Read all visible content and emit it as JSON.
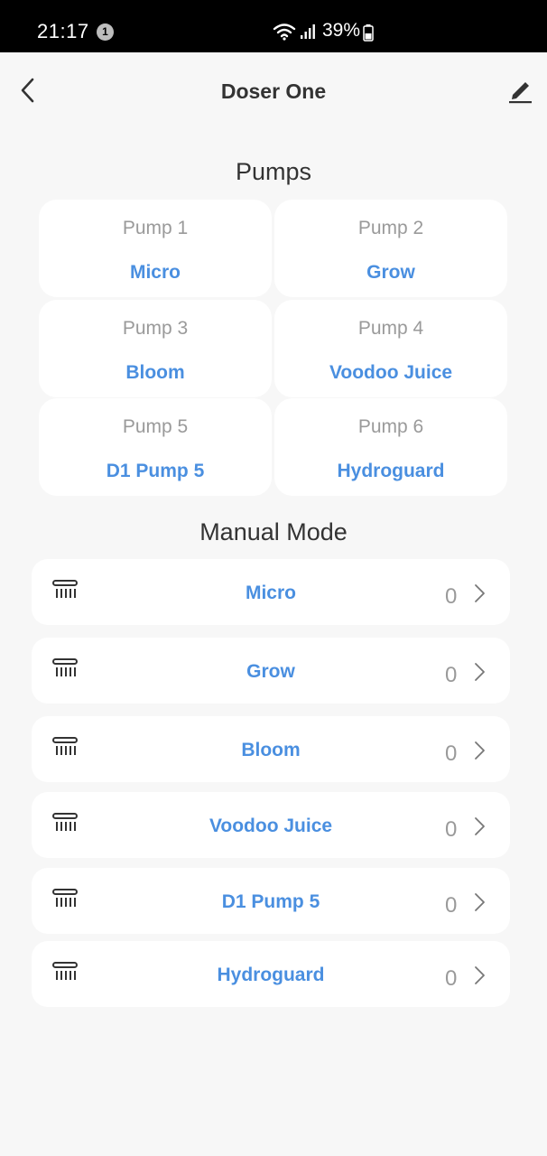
{
  "status_bar": {
    "time": "21:17",
    "notification_count": "1",
    "battery": "39%"
  },
  "header": {
    "title": "Doser One"
  },
  "pumps": {
    "title": "Pumps",
    "items": [
      {
        "number": "Pump 1",
        "name": "Micro"
      },
      {
        "number": "Pump 2",
        "name": "Grow"
      },
      {
        "number": "Pump 3",
        "name": "Bloom"
      },
      {
        "number": "Pump 4",
        "name": "Voodoo Juice"
      },
      {
        "number": "Pump 5",
        "name": "D1 Pump 5"
      },
      {
        "number": "Pump 6",
        "name": "Hydroguard"
      }
    ]
  },
  "manual_mode": {
    "title": "Manual Mode",
    "rows": [
      {
        "label": "Micro",
        "count": "0"
      },
      {
        "label": "Grow",
        "count": "0"
      },
      {
        "label": "Bloom",
        "count": "0"
      },
      {
        "label": "Voodoo Juice",
        "count": "0"
      },
      {
        "label": "D1 Pump 5",
        "count": "0"
      },
      {
        "label": "Hydroguard",
        "count": "0"
      }
    ]
  },
  "colors": {
    "accent": "#4a8fe0",
    "muted": "#9a9a9a",
    "background": "#f7f7f7"
  }
}
